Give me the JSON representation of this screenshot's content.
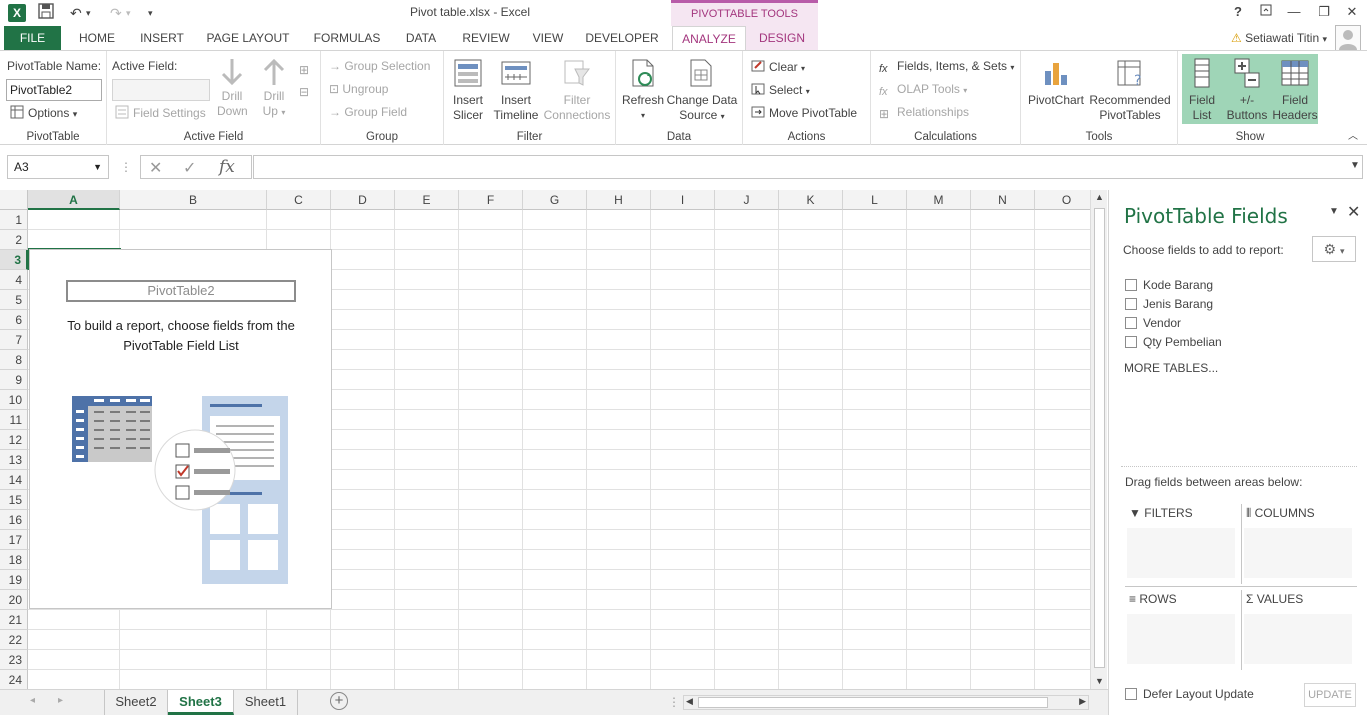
{
  "app": {
    "document_title": "Pivot table.xlsx - Excel",
    "context_header": "PIVOTTABLE TOOLS",
    "help": "?",
    "user_name": "Setiawati Titin"
  },
  "tabs": [
    "FILE",
    "HOME",
    "INSERT",
    "PAGE LAYOUT",
    "FORMULAS",
    "DATA",
    "REVIEW",
    "VIEW",
    "DEVELOPER",
    "ANALYZE",
    "DESIGN"
  ],
  "ribbon": {
    "pivottable": {
      "name_label": "PivotTable Name:",
      "name_value": "PivotTable2",
      "options": "Options",
      "group": "PivotTable"
    },
    "active_field": {
      "label": "Active Field:",
      "field_settings": "Field Settings",
      "drill_down": [
        "Drill",
        "Down"
      ],
      "drill_up": [
        "Drill",
        "Up"
      ],
      "group": "Active Field"
    },
    "group": {
      "group_selection": "Group Selection",
      "ungroup": "Ungroup",
      "group_field": "Group Field",
      "group": "Group"
    },
    "filter": {
      "insert_slicer": [
        "Insert",
        "Slicer"
      ],
      "insert_timeline": [
        "Insert",
        "Timeline"
      ],
      "filter_connections": [
        "Filter",
        "Connections"
      ],
      "group": "Filter"
    },
    "data": {
      "refresh": "Refresh",
      "change_data_source": [
        "Change Data",
        "Source"
      ],
      "group": "Data"
    },
    "actions": {
      "clear": "Clear",
      "select": "Select",
      "move_pivottable": "Move PivotTable",
      "group": "Actions"
    },
    "calculations": {
      "fields_items_sets": "Fields, Items, & Sets",
      "olap_tools": "OLAP Tools",
      "relationships": "Relationships",
      "group": "Calculations"
    },
    "tools": {
      "pivotchart": "PivotChart",
      "recommended": [
        "Recommended",
        "PivotTables"
      ],
      "group": "Tools"
    },
    "show": {
      "field_list": [
        "Field",
        "List"
      ],
      "buttons": [
        "+/-",
        "Buttons"
      ],
      "field_headers": [
        "Field",
        "Headers"
      ],
      "group": "Show"
    }
  },
  "formula_bar": {
    "name_box": "A3",
    "fx": "fx",
    "formula": ""
  },
  "grid": {
    "columns": [
      "A",
      "B",
      "C",
      "D",
      "E",
      "F",
      "G",
      "H",
      "I",
      "J",
      "K",
      "L",
      "M",
      "N",
      "O"
    ],
    "rows": [
      "1",
      "2",
      "3",
      "4",
      "5",
      "6",
      "7",
      "8",
      "9",
      "10",
      "11",
      "12",
      "13",
      "14",
      "15",
      "16",
      "17",
      "18",
      "19",
      "20",
      "21",
      "22",
      "23",
      "24"
    ],
    "active_cell": "A3"
  },
  "pivot_placeholder": {
    "title": "PivotTable2",
    "message": "To build a report, choose fields from the PivotTable Field List"
  },
  "sheets": {
    "tabs": [
      "Sheet2",
      "Sheet3",
      "Sheet1"
    ],
    "active": "Sheet3"
  },
  "pane": {
    "title": "PivotTable Fields",
    "subtitle": "Choose fields to add to report:",
    "fields": [
      "Kode Barang",
      "Jenis Barang",
      "Vendor",
      "Qty Pembelian"
    ],
    "more_tables": "MORE TABLES...",
    "drag_msg": "Drag fields between areas below:",
    "areas": {
      "filters": "FILTERS",
      "columns": "COLUMNS",
      "rows": "ROWS",
      "values": "VALUES"
    },
    "defer": "Defer Layout Update",
    "update": "UPDATE"
  },
  "colors": {
    "excel_green": "#217346",
    "context_pink": "#a3367e",
    "show_highlight": "#9fd5b7"
  }
}
